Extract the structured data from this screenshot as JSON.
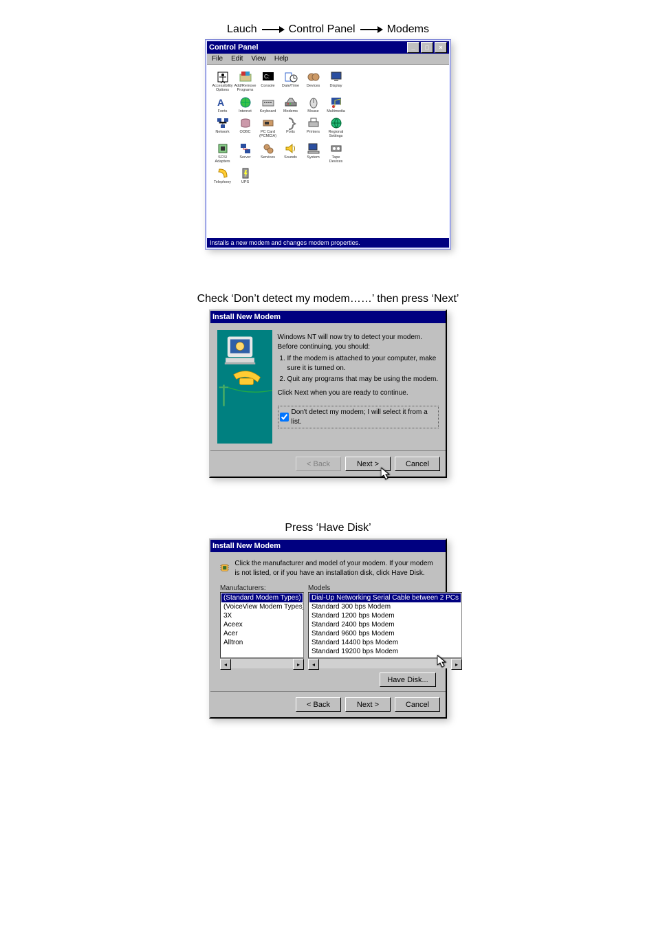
{
  "figure1": {
    "caption_parts": [
      "Lauch ",
      "Control Panel",
      "Modems"
    ],
    "window_title": "Control Panel",
    "menu": [
      "File",
      "Edit",
      "View",
      "Help"
    ],
    "status": "Installs a new modem and changes modem properties.",
    "icons": [
      {
        "name": "accessibility-icon",
        "label": "Accessibility Options"
      },
      {
        "name": "add-remove-programs-icon",
        "label": "Add/Remove Programs"
      },
      {
        "name": "console-icon",
        "label": "Console"
      },
      {
        "name": "date-time-icon",
        "label": "Date/Time"
      },
      {
        "name": "devices-icon",
        "label": "Devices"
      },
      {
        "name": "display-icon",
        "label": "Display"
      },
      {
        "name": "fonts-icon",
        "label": "Fonts"
      },
      {
        "name": "internet-icon",
        "label": "Internet"
      },
      {
        "name": "keyboard-icon",
        "label": "Keyboard"
      },
      {
        "name": "modems-icon",
        "label": "Modems"
      },
      {
        "name": "mouse-icon",
        "label": "Mouse"
      },
      {
        "name": "multimedia-icon",
        "label": "Multimedia"
      },
      {
        "name": "network-icon",
        "label": "Network"
      },
      {
        "name": "odbc-icon",
        "label": "ODBC"
      },
      {
        "name": "pc-card-icon",
        "label": "PC Card (PCMCIA)"
      },
      {
        "name": "ports-icon",
        "label": "Ports"
      },
      {
        "name": "printers-icon",
        "label": "Printers"
      },
      {
        "name": "regional-settings-icon",
        "label": "Regional Settings"
      },
      {
        "name": "scsi-adapters-icon",
        "label": "SCSI Adapters"
      },
      {
        "name": "server-icon",
        "label": "Server"
      },
      {
        "name": "services-icon",
        "label": "Services"
      },
      {
        "name": "sounds-icon",
        "label": "Sounds"
      },
      {
        "name": "system-icon",
        "label": "System"
      },
      {
        "name": "tape-devices-icon",
        "label": "Tape Devices"
      },
      {
        "name": "telephony-icon",
        "label": "Telephony"
      },
      {
        "name": "ups-icon",
        "label": "UPS"
      }
    ]
  },
  "figure2": {
    "caption": "Check ‘Don’t detect my modem……’ then press ‘Next’",
    "window_title": "Install New Modem",
    "intro": "Windows NT will now try to detect your modem.  Before continuing, you should:",
    "steps": [
      "If the modem is attached to your computer, make sure it is turned on.",
      "Quit any programs that may be using the modem."
    ],
    "ready_text": "Click Next when you are ready to continue.",
    "checkbox_label": "Don't detect my modem; I will select it from a list.",
    "buttons": {
      "back": "< Back",
      "next": "Next >",
      "cancel": "Cancel"
    }
  },
  "figure3": {
    "caption": "Press ‘Have Disk’",
    "window_title": "Install New Modem",
    "instruction": "Click the manufacturer and model of your modem. If your modem is not listed, or if you have an installation disk, click Have Disk.",
    "manu_label": "Manufacturers:",
    "models_label": "Models",
    "manufacturers": [
      "(Standard Modem Types)",
      "(VoiceView Modem Types)",
      "3X",
      "Aceex",
      "Acer",
      "Alltron"
    ],
    "models": [
      "Dial-Up Networking Serial Cable between 2 PCs",
      "Standard   300 bps Modem",
      "Standard  1200 bps Modem",
      "Standard  2400 bps Modem",
      "Standard  9600 bps Modem",
      "Standard 14400 bps Modem",
      "Standard 19200 bps Modem"
    ],
    "have_disk": "Have Disk...",
    "buttons": {
      "back": "< Back",
      "next": "Next >",
      "cancel": "Cancel"
    }
  }
}
